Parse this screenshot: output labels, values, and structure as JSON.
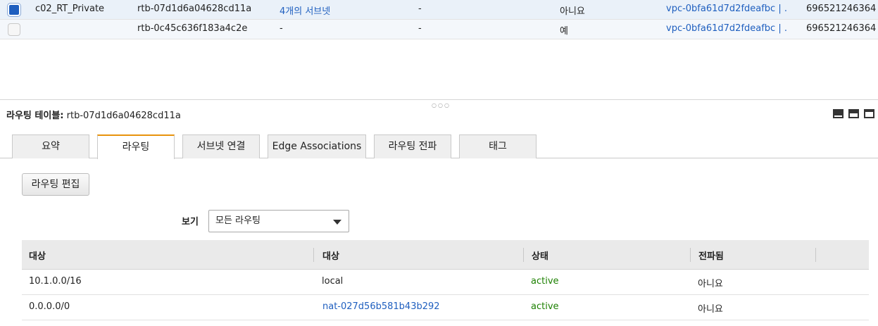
{
  "top_list": {
    "rows": [
      {
        "name": "c02_RT_Private",
        "id": "rtb-07d1d6a04628cd11a",
        "subnets": "4개의 서브넷",
        "edge": "-",
        "main": "아니요",
        "vpc": "vpc-0bfa61d7d2fdeafbc | ...",
        "owner": "696521246364"
      },
      {
        "name": "",
        "id": "rtb-0c45c636f183a4c2e",
        "subnets": "-",
        "edge": "-",
        "main": "예",
        "vpc": "vpc-0bfa61d7d2fdeafbc | ...",
        "owner": "696521246364"
      }
    ]
  },
  "detail": {
    "title_label": "라우팅 테이블:",
    "title_value": "rtb-07d1d6a04628cd11a"
  },
  "tabs": [
    "요약",
    "라우팅",
    "서브넷 연결",
    "Edge Associations",
    "라우팅 전파",
    "태그"
  ],
  "edit_button": "라우팅 편집",
  "filter": {
    "label": "보기",
    "selected": "모든 라우팅"
  },
  "routes": {
    "columns": [
      "대상",
      "대상",
      "상태",
      "전파됨"
    ],
    "rows": [
      {
        "destination": "10.1.0.0/16",
        "target": "local",
        "status": "active",
        "propagated": "아니요"
      },
      {
        "destination": "0.0.0.0/0",
        "target": "nat-027d56b581b43b292",
        "status": "active",
        "propagated": "아니요"
      }
    ]
  },
  "colors": {
    "accent": "#e8930c",
    "link": "#1f5fbf",
    "active": "#1d8102"
  }
}
